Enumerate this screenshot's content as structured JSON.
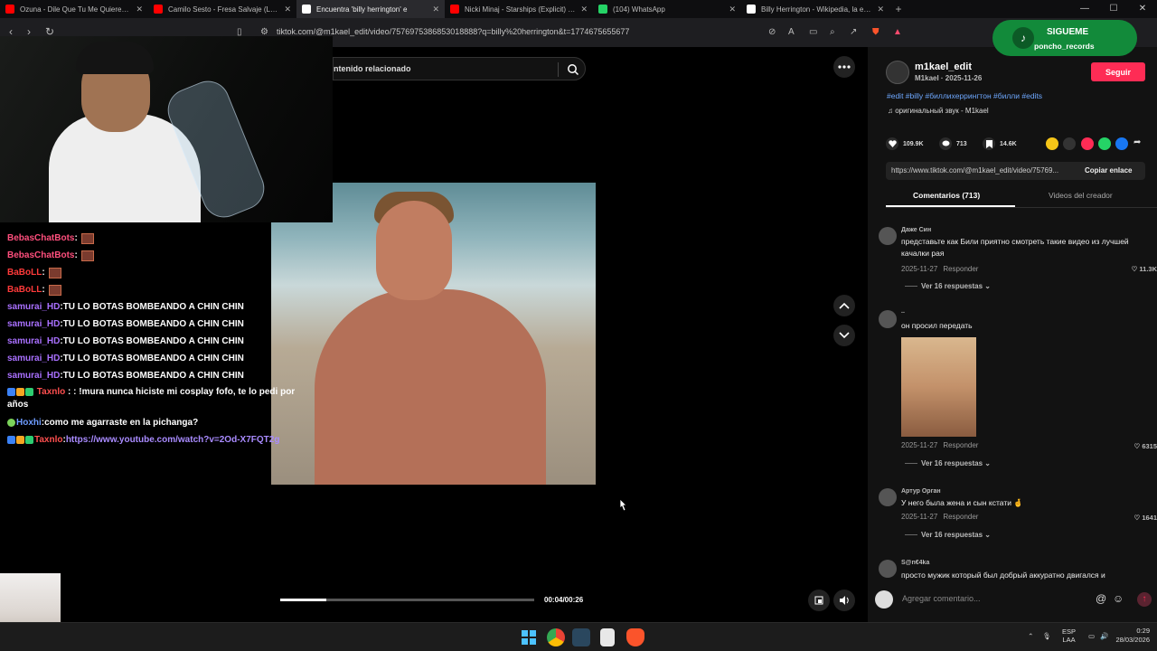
{
  "browser": {
    "tabs": [
      {
        "title": "Ozuna - Dile Que Tu Me Quieres (Au",
        "icon": "youtube-icon",
        "color": "#ff0000"
      },
      {
        "title": "Camilo Sesto - Fresa Salvaje (Luces E",
        "icon": "youtube-icon",
        "color": "#ff0000"
      },
      {
        "title": "Encuentra 'billy herrington' e",
        "icon": "tiktok-icon",
        "color": "#ffffff",
        "active": true
      },
      {
        "title": "Nicki Minaj - Starships (Explicit) (Offi",
        "icon": "youtube-icon",
        "color": "#ff0000"
      },
      {
        "title": "(104) WhatsApp",
        "icon": "whatsapp-icon",
        "color": "#25d366"
      },
      {
        "title": "Billy Herrington - Wikipedia, la encicl",
        "icon": "wikipedia-icon",
        "color": "#ffffff"
      }
    ],
    "url": "tiktok.com/@m1kael_edit/video/7576975386853018888?q=billy%20herrington&t=1774675655677"
  },
  "overlay": {
    "sigueme_title": "SIGUEME",
    "sigueme_handle": "poncho_records"
  },
  "chat": [
    {
      "user": "BebasChatBots",
      "sep": " :",
      "msg": "",
      "emote": true,
      "cls": "u-bebas"
    },
    {
      "user": "BebasChatBots",
      "sep": " :",
      "msg": "",
      "emote": true,
      "cls": "u-bebas"
    },
    {
      "user": "BaBoLL",
      "sep": " :",
      "msg": "",
      "emote": true,
      "cls": "u-babo"
    },
    {
      "user": "BaBoLL",
      "sep": " :",
      "msg": "",
      "emote": true,
      "cls": "u-babo"
    },
    {
      "user": "samurai_HD",
      "sep": " :",
      "msg": " TU LO BOTAS BOMBEANDO A CHIN CHIN",
      "cls": "u-samurai"
    },
    {
      "user": "samurai_HD",
      "sep": " :",
      "msg": " TU LO BOTAS BOMBEANDO A CHIN CHIN",
      "cls": "u-samurai"
    },
    {
      "user": "samurai_HD",
      "sep": " :",
      "msg": " TU LO BOTAS BOMBEANDO A CHIN CHIN",
      "cls": "u-samurai"
    },
    {
      "user": "samurai_HD",
      "sep": " :",
      "msg": " TU LO BOTAS BOMBEANDO A CHIN CHIN",
      "cls": "u-samurai"
    },
    {
      "user": "samurai_HD",
      "sep": " :",
      "msg": " TU LO BOTAS BOMBEANDO A CHIN CHIN",
      "cls": "u-samurai"
    },
    {
      "user": "Taxnlo",
      "sep": " :",
      "msg": " : !mura nunca hiciste mi cosplay fofo, te lo pedi por años",
      "cls": "u-taxnlo",
      "badges": 3,
      "wrap": true
    },
    {
      "user": "Hoxhi",
      "sep": " :",
      "msg": " como me agarraste en la pichanga?",
      "cls": "u-hoxhi",
      "badges": 1
    },
    {
      "user": "Taxnlo",
      "sep": " :",
      "msg": "",
      "link": "https://www.youtube.com/watch?v=2Od-X7FQT2g",
      "cls": "u-taxnlo",
      "badges": 3
    }
  ],
  "video": {
    "related_search": "ntenido relacionado",
    "progress": 0.18,
    "time": "00:04/00:26"
  },
  "post": {
    "username": "m1kael_edit",
    "subline": "M1kael · 2025-11-26",
    "follow_label": "Seguir",
    "hashtags": "#edit #billy #биллихеррингтон #билли #edits",
    "sound": "оригинальный звук - M1kael",
    "likes": "109.9K",
    "comments": "713",
    "saves": "14.6K",
    "link": "https://www.tiktok.com/@m1kael_edit/video/75769...",
    "copy_label": "Copiar enlace",
    "tab_comments": "Comentarios (713)",
    "tab_creator": "Videos del creador",
    "input_placeholder": "Agregar comentario..."
  },
  "comments": [
    {
      "name": "Даже Син",
      "text": "представьте как Били приятно смотреть такие видео из лучшей качалки рая",
      "date": "2025-11-27",
      "reply": "Responder",
      "likes": "11.3K",
      "replies": "Ver 16 respuestas"
    },
    {
      "name": "..",
      "text": "он просил передать",
      "date": "2025-11-27",
      "reply": "Responder",
      "likes": "6315",
      "replies": "Ver 16 respuestas",
      "photo": true
    },
    {
      "name": "Артур Орган",
      "text": "У него была жена и сын кстати 🤞",
      "date": "2025-11-27",
      "reply": "Responder",
      "likes": "1641",
      "replies": "Ver 16 respuestas"
    },
    {
      "name": "S@n€4ka",
      "text": "просто мужик который был добрый аккуратно двигался и"
    }
  ],
  "taskbar": {
    "lang1": "ESP",
    "lang2": "LAA",
    "time": "0:29",
    "date": "28/03/2026"
  }
}
